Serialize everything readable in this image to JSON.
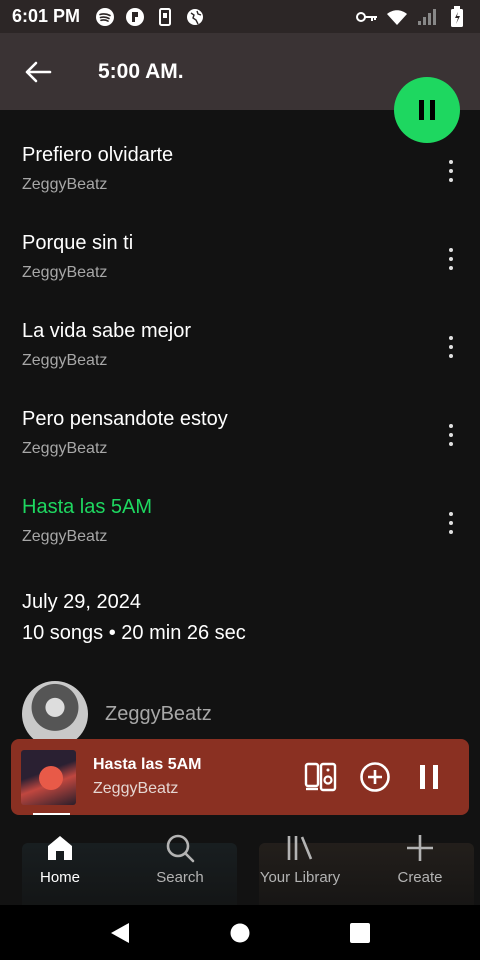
{
  "status_bar": {
    "time": "6:01 PM",
    "icons_left": [
      "spotify-icon",
      "app-icon",
      "device-icon",
      "vpn-globe-icon"
    ],
    "icons_right": [
      "key-icon",
      "wifi-icon",
      "signal-icon",
      "battery-icon"
    ]
  },
  "header": {
    "title": "5:00 AM."
  },
  "tracks": [
    {
      "title": "Prefiero olvidarte",
      "artist": "ZeggyBeatz",
      "playing": false
    },
    {
      "title": "Porque sin ti",
      "artist": "ZeggyBeatz",
      "playing": false
    },
    {
      "title": "La vida sabe mejor",
      "artist": "ZeggyBeatz",
      "playing": false
    },
    {
      "title": "Pero pensandote estoy",
      "artist": "ZeggyBeatz",
      "playing": false
    },
    {
      "title": "Hasta las 5AM",
      "artist": "ZeggyBeatz",
      "playing": true
    }
  ],
  "album_meta": {
    "date": "July 29, 2024",
    "summary": "10 songs • 20 min 26 sec"
  },
  "artist": {
    "name": "ZeggyBeatz"
  },
  "mini_player": {
    "title": "Hasta las 5AM",
    "artist": "ZeggyBeatz",
    "progress": 0.09
  },
  "bottom_nav": {
    "items": [
      {
        "label": "Home",
        "icon": "home-icon",
        "active": true
      },
      {
        "label": "Search",
        "icon": "search-icon",
        "active": false
      },
      {
        "label": "Your Library",
        "icon": "library-icon",
        "active": false
      },
      {
        "label": "Create",
        "icon": "plus-icon",
        "active": false
      }
    ]
  },
  "colors": {
    "accent": "#1ed760",
    "mini_player_bg": "#8a3022",
    "header_bg": "#3a3334",
    "background": "#121212"
  }
}
